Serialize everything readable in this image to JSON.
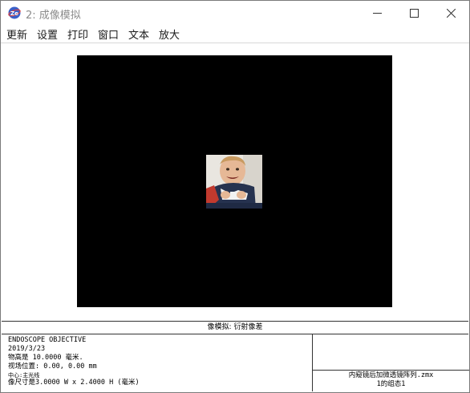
{
  "window": {
    "title": "2: 成像模拟",
    "app_icon": "zemax-logo-icon",
    "controls": [
      "minimize-icon",
      "maximize-icon",
      "close-icon"
    ]
  },
  "menu": {
    "items": [
      {
        "label": "更新"
      },
      {
        "label": "设置"
      },
      {
        "label": "打印"
      },
      {
        "label": "窗口"
      },
      {
        "label": "文本"
      },
      {
        "label": "放大"
      }
    ]
  },
  "viewport": {
    "background": "#000000",
    "image_subject": "child-photo"
  },
  "caption": "像模拟: 衍射像差",
  "info": {
    "left_lines": [
      "ENDOSCOPE OBJECTIVE",
      "2019/3/23",
      "物高是 10.0000 毫米.",
      "视场位置: 0.00, 0.00 mm",
      "中心:主光线",
      "像尺寸是3.0000 W x 2.4000 H (毫米)"
    ],
    "right_lines": [
      "内窥镜后加微透镜阵列.zmx",
      "1的组态1"
    ]
  }
}
